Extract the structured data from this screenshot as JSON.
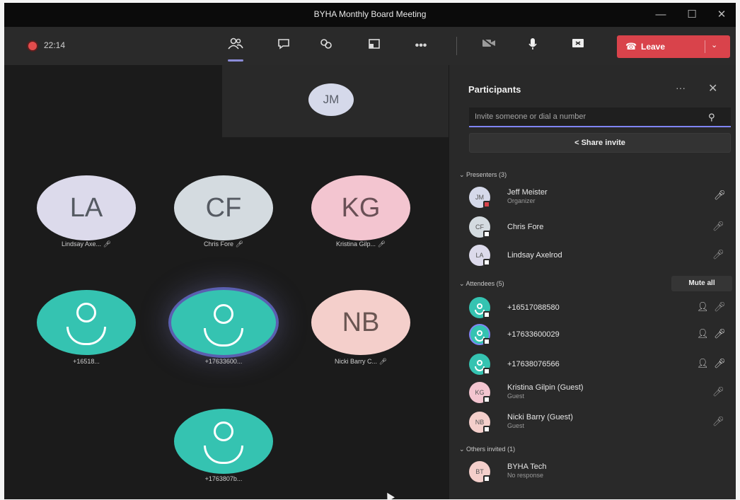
{
  "window": {
    "title": "BYHA Monthly Board Meeting",
    "controls": {
      "minimize": "—",
      "maximize": "☐",
      "close": "✕"
    }
  },
  "toolbar": {
    "recording_time": "22:14",
    "icons": [
      "people-icon",
      "chat-icon",
      "reactions-icon",
      "share-tray-icon",
      "more-icon",
      "camera-icon",
      "mic-icon",
      "share-screen-icon"
    ],
    "more": "•••",
    "leave": {
      "label": "Leave",
      "phone": "☎",
      "chevron": "⌄"
    },
    "leave_color": "#d9434b"
  },
  "stage": {
    "pinned": {
      "initials": "JM"
    },
    "tiles": [
      {
        "initials": "LA",
        "label": "Lindsay Axe... ",
        "color": "#dcdaeb"
      },
      {
        "initials": "CF",
        "label": "Chris Fore ",
        "color": "#d4dbe0"
      },
      {
        "initials": "KG",
        "label": "Kristina Gilp... ",
        "color": "#f3c5d0"
      },
      {
        "initials": "",
        "label": "+16518... ",
        "color": "#35c3b1"
      },
      {
        "initials": "",
        "label": "+17633600... ",
        "color": "#35c3b1"
      },
      {
        "initials": "NB",
        "label": "Nicki Barry C... ",
        "color": "#f4cfcb"
      },
      {
        "initials": "",
        "label": "+1763807b... ",
        "color": "#35c3b1"
      }
    ]
  },
  "participants": {
    "title": "Participants",
    "more": "···",
    "close": "✕",
    "search": {
      "placeholder": "Invite someone or dial a number"
    },
    "share_invite": "Share invite",
    "presenters": {
      "heading": "⌄  Presenters (3)",
      "items": [
        {
          "initials": "JM",
          "name": "Jeff Meister",
          "sub": "Organizer",
          "color": "#d5d9ea"
        },
        {
          "initials": "CF",
          "name": "Chris Fore",
          "sub": "",
          "color": "#d4dbe0"
        },
        {
          "initials": "LA",
          "name": "Lindsay Axelrod",
          "sub": "",
          "color": "#dcdaeb"
        }
      ]
    },
    "attendees": {
      "heading": "⌄  Attendees (5)",
      "mute_all": "Mute all",
      "items": [
        {
          "initials": "",
          "name": "+16517088580",
          "sub": "",
          "color": "#35c3b1"
        },
        {
          "initials": "",
          "name": "+17633600029",
          "sub": "",
          "color": "#35c3b1"
        },
        {
          "initials": "",
          "name": "+17638076566",
          "sub": "",
          "color": "#35c3b1"
        },
        {
          "initials": "KG",
          "name": "Kristina Gilpin (Guest)",
          "sub": "Guest",
          "color": "#f3c5d0"
        },
        {
          "initials": "NB",
          "name": "Nicki Barry (Guest)",
          "sub": "Guest",
          "color": "#f4cfcb"
        }
      ]
    },
    "others": {
      "heading": "⌄  Others invited (1)",
      "items": [
        {
          "initials": "BT",
          "name": "BYHA Tech",
          "sub": "No response",
          "color": "#f4cfcb"
        }
      ]
    }
  }
}
